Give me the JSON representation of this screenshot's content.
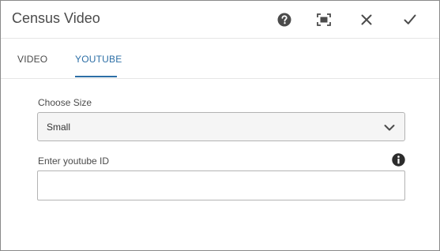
{
  "dialog": {
    "title": "Census Video",
    "icons": {
      "help": "help-icon",
      "fullscreen": "fullscreen-icon",
      "close": "close-icon",
      "done": "checkmark-icon"
    }
  },
  "tabs": [
    {
      "label": "VIDEO",
      "active": false
    },
    {
      "label": "YOUTUBE",
      "active": true
    }
  ],
  "colors": {
    "accent": "#2d6fa6",
    "text": "#4b4b4b",
    "icon": "#4b4b4b"
  },
  "form": {
    "size": {
      "label": "Choose Size",
      "value": "Small"
    },
    "youtube_id": {
      "label": "Enter youtube ID",
      "value": "",
      "info_icon": "info-icon"
    }
  }
}
